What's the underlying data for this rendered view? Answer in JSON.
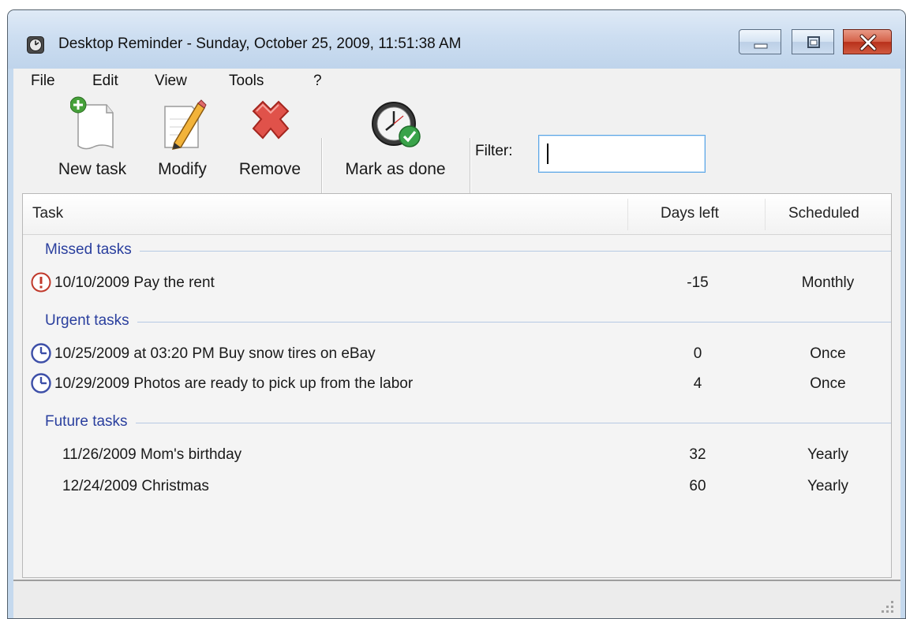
{
  "window": {
    "title": "Desktop Reminder - Sunday, October 25, 2009, 11:51:38 AM"
  },
  "menu": [
    "File",
    "Edit",
    "View",
    "Tools",
    "?"
  ],
  "toolbar": {
    "new_task": "New task",
    "modify": "Modify",
    "remove": "Remove",
    "mark_done": "Mark as done",
    "filter_label": "Filter:",
    "filter_value": ""
  },
  "columns": {
    "task": "Task",
    "days_left": "Days left",
    "scheduled": "Scheduled"
  },
  "groups": [
    {
      "title": "Missed tasks",
      "rows": [
        {
          "icon": "exclamation-icon",
          "task": "10/10/2009 Pay the rent",
          "days": "-15",
          "scheduled": "Monthly"
        }
      ]
    },
    {
      "title": "Urgent tasks",
      "rows": [
        {
          "icon": "clock-icon",
          "task": "10/25/2009 at 03:20 PM Buy snow tires on eBay",
          "days": "0",
          "scheduled": "Once"
        },
        {
          "icon": "clock-icon",
          "task": "10/29/2009 Photos are ready to pick up from the labor",
          "days": "4",
          "scheduled": "Once"
        }
      ]
    },
    {
      "title": "Future tasks",
      "rows": [
        {
          "icon": "",
          "task": "11/26/2009 Mom's birthday",
          "days": "32",
          "scheduled": "Yearly"
        },
        {
          "icon": "",
          "task": "12/24/2009 Christmas",
          "days": "60",
          "scheduled": "Yearly"
        }
      ]
    }
  ],
  "colors": {
    "group_title": "#2a3f9e",
    "missed_icon": "#c0392b",
    "urgent_icon": "#3d4fa8"
  }
}
